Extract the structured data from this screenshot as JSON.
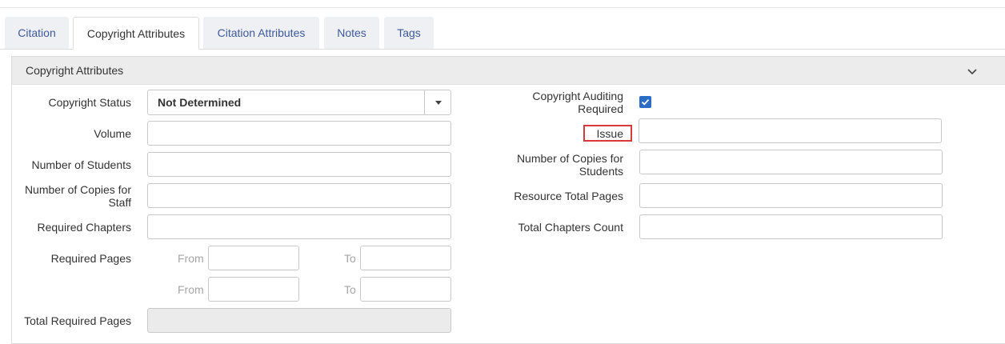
{
  "tabs": [
    {
      "label": "Citation"
    },
    {
      "label": "Copyright Attributes"
    },
    {
      "label": "Citation Attributes"
    },
    {
      "label": "Notes"
    },
    {
      "label": "Tags"
    }
  ],
  "panel": {
    "title": "Copyright Attributes",
    "toggle_icon": "chevron-down-icon"
  },
  "left": {
    "copyright_status": {
      "label": "Copyright Status",
      "value": "Not Determined"
    },
    "volume": {
      "label": "Volume",
      "value": ""
    },
    "number_of_students": {
      "label": "Number of Students",
      "value": ""
    },
    "copies_for_staff": {
      "label_line1": "Number of Copies for",
      "label_line2": "Staff",
      "value": ""
    },
    "required_chapters": {
      "label": "Required Chapters",
      "value": ""
    },
    "required_pages": {
      "label": "Required Pages",
      "from_label": "From",
      "to_label": "To",
      "ranges": [
        {
          "from": "",
          "to": ""
        },
        {
          "from": "",
          "to": ""
        }
      ]
    },
    "total_required_pages": {
      "label": "Total Required Pages",
      "value": ""
    }
  },
  "right": {
    "auditing": {
      "label_line1": "Copyright Auditing",
      "label_line2": "Required",
      "checked": true
    },
    "issue": {
      "label": "Issue",
      "value": ""
    },
    "copies_for_students": {
      "label_line1": "Number of Copies for",
      "label_line2": "Students",
      "value": ""
    },
    "resource_total_pages": {
      "label": "Resource Total Pages",
      "value": ""
    },
    "total_chapters_count": {
      "label": "Total Chapters Count",
      "value": ""
    }
  },
  "colors": {
    "tab_text": "#3d5a99",
    "highlight": "#d83a3a",
    "checkbox": "#2b6cc4"
  }
}
